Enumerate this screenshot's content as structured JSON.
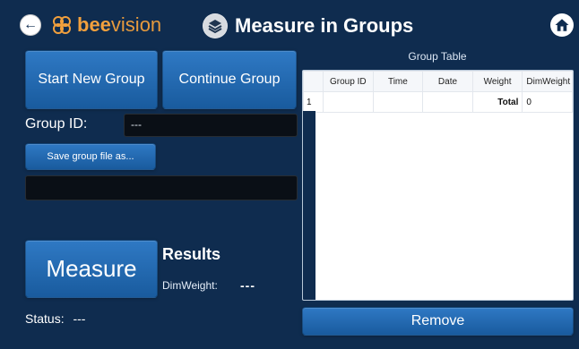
{
  "header": {
    "logo_bold": "bee",
    "logo_light": "vision",
    "title": "Measure in Groups"
  },
  "actions": {
    "start_new_group": "Start New Group",
    "continue_group": "Continue Group",
    "save_group_file": "Save group file as...",
    "measure": "Measure",
    "remove": "Remove"
  },
  "group": {
    "label": "Group ID:",
    "value": "---",
    "file_path_value": ""
  },
  "results": {
    "title": "Results",
    "dimweight_label": "DimWeight:",
    "dimweight_value": "---"
  },
  "status": {
    "label": "Status:",
    "value": "---"
  },
  "table": {
    "caption": "Group Table",
    "columns": [
      "Group ID",
      "Time",
      "Date",
      "Weight",
      "DimWeight"
    ],
    "rows": [
      {
        "index": "1",
        "group_id": "",
        "time": "",
        "date": "",
        "weight": "Total",
        "dimweight": "0"
      }
    ]
  },
  "icons": {
    "back": "back-arrow-icon",
    "home": "home-icon",
    "measure_groups": "measure-groups-icon"
  }
}
